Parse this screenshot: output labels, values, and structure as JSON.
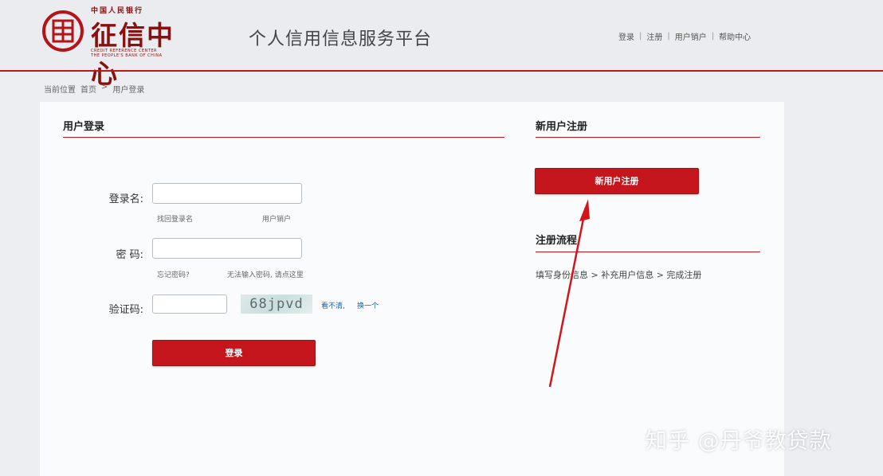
{
  "header": {
    "logo_top": "中国人民银行",
    "logo_main": "征信中心",
    "logo_en_line1": "CREDIT REFERENCE CENTER",
    "logo_en_line2": "THE PEOPLE'S BANK OF CHINA",
    "platform_title": "个人信用信息服务平台",
    "nav": {
      "login": "登录",
      "register": "注册",
      "user_account": "用户销户",
      "help": "帮助中心",
      "separator": "|"
    }
  },
  "breadcrumb": {
    "current_position": "当前位置",
    "home": "首页",
    "arrow": ">",
    "current": "用户登录"
  },
  "login": {
    "section_title": "用户登录",
    "username_label": "登录名:",
    "username_value": "",
    "forgot_username": "找回登录名",
    "user_account_link": "用户销户",
    "password_label": "密  码:",
    "password_value": "",
    "forgot_password": "忘记密码?",
    "cannot_input_password": "无法输入密码, 请点这里",
    "captcha_label": "验证码:",
    "captcha_value": "",
    "captcha_text": "68jpvd",
    "captcha_unclear": "看不清,",
    "captcha_refresh": "换一个",
    "login_button": "登录"
  },
  "register": {
    "section_title": "新用户注册",
    "register_button": "新用户注册",
    "flow_title": "注册流程",
    "flow_steps": "填写身份信息 > 补充用户信息 > 完成注册"
  },
  "watermark": "知乎 @丹爷教贷款",
  "colors": {
    "brand_red": "#c4161c",
    "annotation_arrow": "#d0161a"
  }
}
